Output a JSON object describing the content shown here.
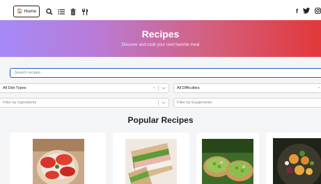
{
  "nav": {
    "home_icon": "🏠",
    "home_label": "Home",
    "icons": [
      "search-icon",
      "list-icon",
      "trash-icon",
      "utensils-icon"
    ],
    "social": [
      {
        "name": "facebook-icon",
        "glyph": "f"
      },
      {
        "name": "twitter-icon",
        "glyph": "𝕐"
      },
      {
        "name": "instagram-icon",
        "glyph": "◎"
      }
    ]
  },
  "hero": {
    "title": "Recipes",
    "subtitle": "Discover and cook your next favorite meal"
  },
  "filters": {
    "search_placeholder": "Search recipes...",
    "diet_value": "All Diet Types",
    "difficulty_value": "All Difficulties",
    "ingredients_placeholder": "Filter by Ingredients",
    "equipments_placeholder": "Filter by Equipments",
    "clear_glyph": "×"
  },
  "section": {
    "title": "Popular Recipes"
  },
  "recipes": [
    {
      "name": "recipe-card-tomato-toast"
    },
    {
      "name": "recipe-card-sandwich"
    },
    {
      "name": "recipe-card-pea-avocado-toast"
    },
    {
      "name": "recipe-card-veggie-bowl"
    }
  ]
}
